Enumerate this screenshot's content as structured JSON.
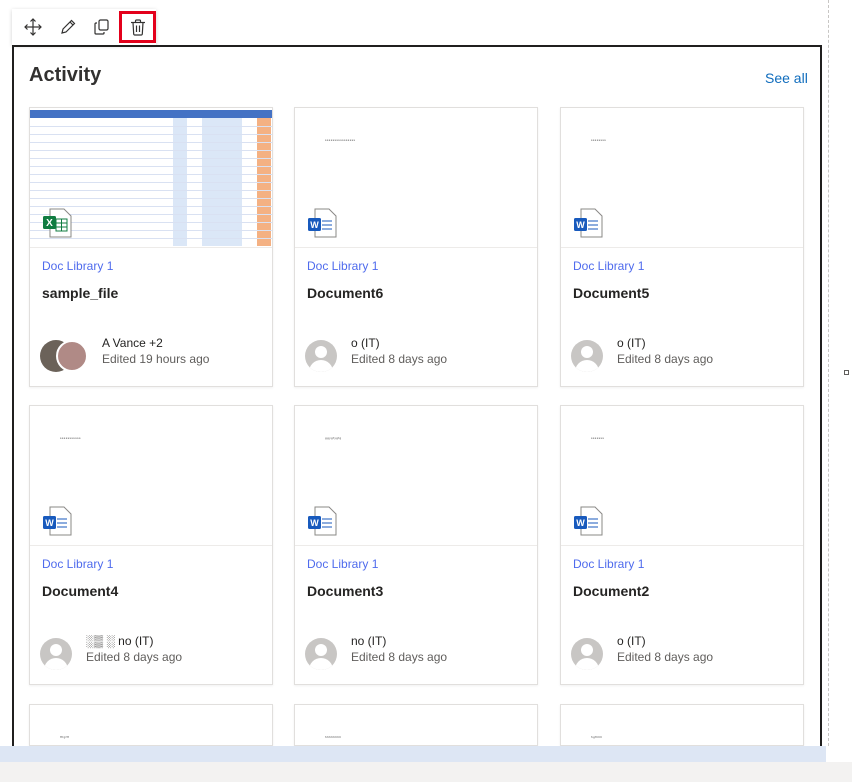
{
  "toolbar": {
    "buttons": [
      {
        "name": "move-icon",
        "selected": false
      },
      {
        "name": "edit-pencil-icon",
        "selected": false
      },
      {
        "name": "duplicate-icon",
        "selected": false
      },
      {
        "name": "delete-trash-icon",
        "selected": true
      }
    ]
  },
  "webpart": {
    "title": "Activity",
    "see_all": "See all"
  },
  "cards": [
    {
      "library": "Doc Library 1",
      "name": "sample_file",
      "who": "A      Vance +2",
      "edited": "Edited 19 hours ago",
      "type": "excel",
      "preview": ""
    },
    {
      "library": "Doc Library 1",
      "name": "Document6",
      "who": "       o (IT)",
      "edited": "Edited 8 days ago",
      "type": "word",
      "preview": "ssssssssssssssss"
    },
    {
      "library": "Doc Library 1",
      "name": "Document5",
      "who": "       o (IT)",
      "edited": "Edited 8 days ago",
      "type": "word",
      "preview": "ssssssss"
    },
    {
      "library": "Doc Library 1",
      "name": "Document4",
      "who": "░▒ ░ no (IT)",
      "edited": "Edited 8 days ago",
      "type": "word",
      "preview": "sssssssssss"
    },
    {
      "library": "Doc Library 1",
      "name": "Document3",
      "who": "       no (IT)",
      "edited": "Edited 8 days ago",
      "type": "word",
      "preview": "ggygfygfg"
    },
    {
      "library": "Doc Library 1",
      "name": "Document2",
      "who": "       o (IT)",
      "edited": "Edited 8 days ago",
      "type": "word",
      "preview": "sssssss"
    },
    {
      "library": "",
      "name": "",
      "who": "",
      "edited": "",
      "type": "word",
      "preview": "fffgfff"
    },
    {
      "library": "",
      "name": "",
      "who": "",
      "edited": "",
      "type": "word",
      "preview": "hhhhhhhh"
    },
    {
      "library": "",
      "name": "",
      "who": "",
      "edited": "",
      "type": "word",
      "preview": "hgfhhh"
    }
  ],
  "colors": {
    "accent": "#0f6cbd",
    "library_link": "#4f6bed",
    "selection_outline": "#e3001b",
    "word_blue": "#185abd",
    "excel_green": "#107c41"
  }
}
